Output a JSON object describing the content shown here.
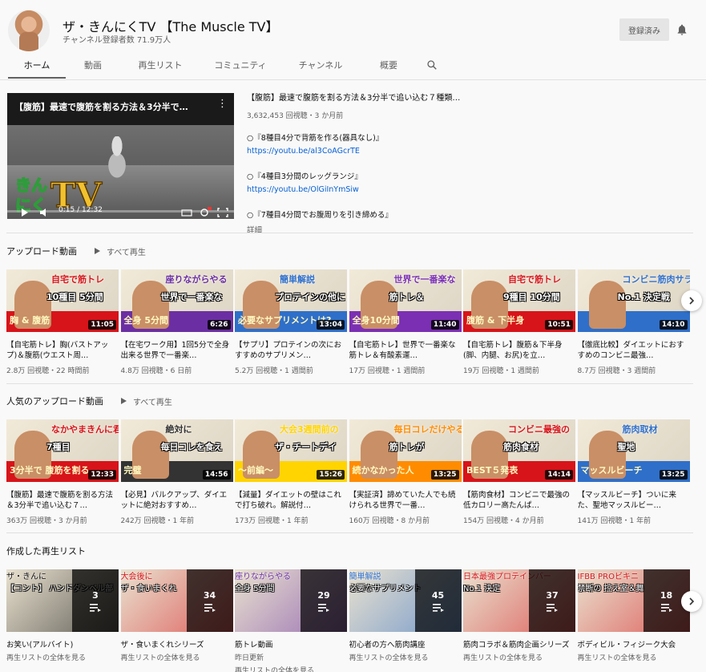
{
  "channel": {
    "name": "ザ・きんにくTV 【The Muscle TV】",
    "subscribers": "チャンネル登録者数 71.9万人",
    "subscribe_label": "登録済み"
  },
  "tabs": [
    "ホーム",
    "動画",
    "再生リスト",
    "コミュニティ",
    "チャンネル",
    "概要"
  ],
  "featured": {
    "overlay_title": "【腹筋】最速で腹筋を割る方法＆3分半で…",
    "time": "0:15 / 12:32",
    "logo_text": "きんにくTV",
    "title": "【腹筋】最速で腹筋を割る方法＆3分半で追い込む７種類…",
    "meta": "3,632,453 回視聴・3 か月前",
    "desc": [
      {
        "text": "○『8種目4分で背筋を作る(器具なし)』",
        "link": "https://youtu.be/al3CoAGcrTE"
      },
      {
        "text": "○『4種目3分間のレッグランジ』",
        "link": "https://youtu.be/OlGiInYmSiw"
      },
      {
        "text": "○『7種目4分間でお腹周りを引き締める』",
        "link": ""
      }
    ],
    "more": "詳細"
  },
  "play_all": "すべて再生",
  "uploads": {
    "title": "アップロード動画",
    "videos": [
      {
        "caption1": "自宅で筋トレ",
        "caption2": "10種目 5分間",
        "caption3": "胸 & 腹筋",
        "duration": "11:05",
        "title": "【自宅筋トレ】胸(バストアップ)＆腹筋(ウエスト周…",
        "meta": "2.8万 回視聴・22 時間前",
        "c1": "#ffffff",
        "c2": "#d7141a"
      },
      {
        "caption1": "座りながらやる",
        "caption2": "世界で一番楽な",
        "caption3": "全身 5分間",
        "duration": "6:26",
        "title": "【在宅ワーク用】1回5分で全身出来る世界で一番楽…",
        "meta": "4.8万 回視聴・6 日前",
        "c1": "#ffffff",
        "c2": "#6b2fa3"
      },
      {
        "caption1": "簡単解説",
        "caption2": "プロテインの他に",
        "caption3": "必要なサプリメントは?",
        "duration": "13:04",
        "title": "【サプリ】プロテインの次におすすめのサプリメン…",
        "meta": "5.2万 回視聴・1 週間前",
        "c1": "#f4e04d",
        "c2": "#2f6fc9"
      },
      {
        "caption1": "世界で一番楽な",
        "caption2": "筋トレ＆",
        "caption3": "全身10分間",
        "duration": "11:40",
        "title": "【自宅筋トレ】世界で一番楽な筋トレ＆有酸素運…",
        "meta": "17万 回視聴・1 週間前",
        "c1": "#ffffff",
        "c2": "#7b2fb3"
      },
      {
        "caption1": "自宅で筋トレ",
        "caption2": "9種目 10分間",
        "caption3": "腹筋 & 下半身",
        "duration": "10:51",
        "title": "【自宅筋トレ】腹筋＆下半身(脚、内腿、お尻)を立…",
        "meta": "19万 回視聴・1 週間前",
        "c1": "#ffffff",
        "c2": "#d7141a"
      },
      {
        "caption1": "コンビニ筋肉サラダ",
        "caption2": "No.1 決定戦",
        "caption3": "",
        "duration": "14:10",
        "title": "【徹底比較】ダイエットにおすすめのコンビニ最強…",
        "meta": "8.7万 回視聴・3 週間前",
        "c1": "#2e9c3a",
        "c2": "#2f6fc9"
      }
    ]
  },
  "popular": {
    "title": "人気のアップロード動画",
    "videos": [
      {
        "caption1": "なかやまきんに君と",
        "caption2": "7種目",
        "caption3": "3分半で 腹筋を割る",
        "duration": "12:33",
        "title": "【腹筋】最速で腹筋を割る方法＆3分半で追い込む７…",
        "meta": "363万 回視聴・3 か月前",
        "c1": "#ffffff",
        "c2": "#d7141a"
      },
      {
        "caption1": "絶対に",
        "caption2": "毎日コレを食え",
        "caption3": "完璧",
        "duration": "14:56",
        "title": "【必見】バルクアップ、ダイエットに絶対おすすめ…",
        "meta": "242万 回視聴・1 年前",
        "c1": "#f4c430",
        "c2": "#333333"
      },
      {
        "caption1": "大会3週間前の",
        "caption2": "ザ・チートデイ",
        "caption3": "～前編～",
        "duration": "15:26",
        "title": "【減量】ダイエットの壁はこれで打ち破れ。解説付…",
        "meta": "173万 回視聴・1 年前",
        "c1": "#2f6fc9",
        "c2": "#ffd400"
      },
      {
        "caption1": "毎日コレだけやるんだ",
        "caption2": "筋トレが",
        "caption3": "続かなかった人",
        "duration": "13:25",
        "title": "【実証済】諦めていた人でも続けられる世界で一番…",
        "meta": "160万 回視聴・8 か月前",
        "c1": "#2e9c3a",
        "c2": "#ff8c00"
      },
      {
        "caption1": "コンビニ最強の",
        "caption2": "筋肉食材",
        "caption3": "BEST５発表",
        "duration": "14:14",
        "title": "【筋肉食材】コンビニで最強の低カロリー高たんぱ…",
        "meta": "154万 回視聴・4 か月前",
        "c1": "#2f6fc9",
        "c2": "#d7141a"
      },
      {
        "caption1": "筋肉取材",
        "caption2": "聖地",
        "caption3": "マッスルビーチ",
        "duration": "13:25",
        "title": "【マッスルビーチ】ついに来た、聖地マッスルビー…",
        "meta": "141万 回視聴・1 年前",
        "c1": "#e05a20",
        "c2": "#2f6fc9"
      }
    ]
  },
  "playlists": {
    "title": "作成した再生リスト",
    "items": [
      {
        "caption1": "ザ・きんに",
        "caption2": "【コント】 ハンドダンベル部",
        "count": "3",
        "name": "お笑い(アルバイト)",
        "sub": "",
        "link": "再生リストの全体を見る",
        "c1": "#ffd400",
        "c2": "#111111"
      },
      {
        "caption1": "大会後に",
        "caption2": "ザ・食いまくれ",
        "count": "34",
        "name": "ザ・食いまくれシリーズ",
        "sub": "",
        "link": "再生リストの全体を見る",
        "c1": "#ffffff",
        "c2": "#d7141a"
      },
      {
        "caption1": "座りながらやる",
        "caption2": "全身 5分間",
        "count": "29",
        "name": "筋トレ動画",
        "sub": "昨日更新",
        "link": "再生リストの全体を見る",
        "c1": "#ffffff",
        "c2": "#6b2fa3"
      },
      {
        "caption1": "簡単解説",
        "caption2": "必要なサプリメント",
        "count": "45",
        "name": "初心者の方へ筋肉講座",
        "sub": "",
        "link": "再生リストの全体を見る",
        "c1": "#f4e04d",
        "c2": "#2f6fc9"
      },
      {
        "caption1": "日本最強プロテインバー",
        "caption2": "No.1 決定",
        "count": "37",
        "name": "筋肉コラボ＆筋肉企画シリーズ",
        "sub": "",
        "link": "再生リストの全体を見る",
        "c1": "#2f6fc9",
        "c2": "#d7141a"
      },
      {
        "caption1": "IFBB PROビキニ",
        "caption2": "禁断の 控え室＆舞",
        "count": "18",
        "name": "ボディビル・フィジーク大会",
        "sub": "",
        "link": "再生リストの全体を見る",
        "c1": "#ffffff",
        "c2": "#d7141a"
      }
    ]
  }
}
